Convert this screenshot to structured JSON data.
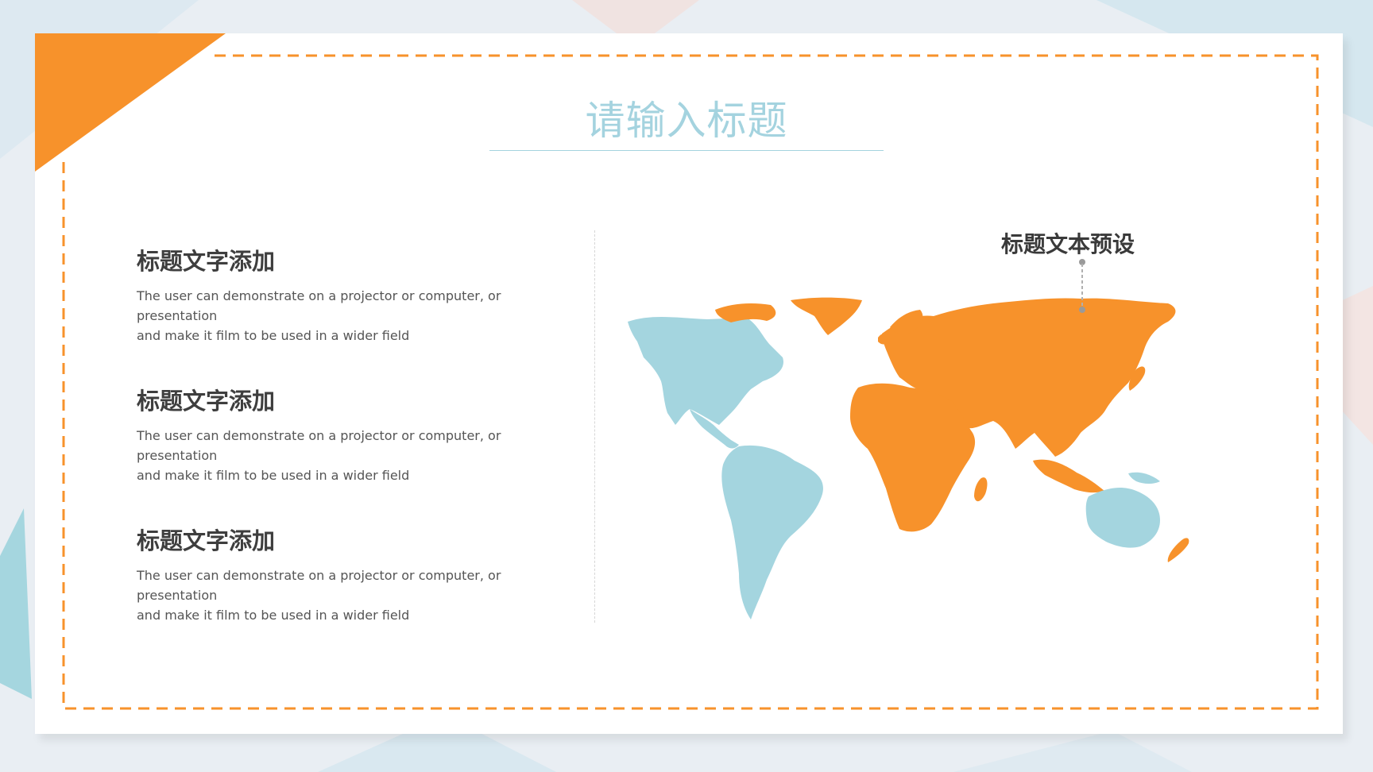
{
  "slide": {
    "title": "请输入标题",
    "items": [
      {
        "heading": "标题文字添加",
        "text_line1": "The user can demonstrate on a projector or computer, or presentation",
        "text_line2": "and make it film to be used in a wider field"
      },
      {
        "heading": "标题文字添加",
        "text_line1": "The user can demonstrate on a projector or computer, or presentation",
        "text_line2": "and make it film to be used in a wider field"
      },
      {
        "heading": "标题文字添加",
        "text_line1": "The user can demonstrate on a projector or computer, or presentation",
        "text_line2": "and make it film to be used in a wider field"
      }
    ],
    "map_callout": "标题文本预设"
  },
  "colors": {
    "accent_orange": "#f7922b",
    "accent_blue": "#a4d5df",
    "background": "#e9eef3"
  }
}
